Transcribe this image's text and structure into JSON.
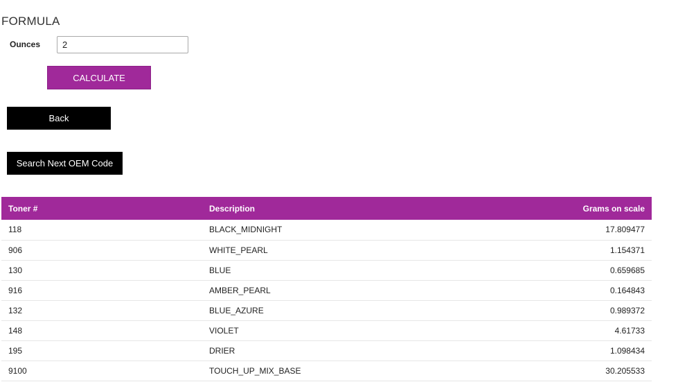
{
  "page": {
    "title": "FORMULA"
  },
  "form": {
    "ounces_label": "Ounces",
    "ounces_value": "2",
    "calculate_label": "CALCULATE",
    "back_label": "Back",
    "search_next_label": "Search Next OEM Code"
  },
  "colors": {
    "accent": "#a0299a",
    "button_dark": "#000000"
  },
  "table": {
    "headers": {
      "toner": "Toner #",
      "description": "Description",
      "grams": "Grams on scale"
    },
    "rows": [
      {
        "toner": "118",
        "description": "BLACK_MIDNIGHT",
        "grams": "17.809477"
      },
      {
        "toner": "906",
        "description": "WHITE_PEARL",
        "grams": "1.154371"
      },
      {
        "toner": "130",
        "description": "BLUE",
        "grams": "0.659685"
      },
      {
        "toner": "916",
        "description": "AMBER_PEARL",
        "grams": "0.164843"
      },
      {
        "toner": "132",
        "description": "BLUE_AZURE",
        "grams": "0.989372"
      },
      {
        "toner": "148",
        "description": "VIOLET",
        "grams": "4.61733"
      },
      {
        "toner": "195",
        "description": "DRIER",
        "grams": "1.098434"
      },
      {
        "toner": "9100",
        "description": "TOUCH_UP_MIX_BASE",
        "grams": "30.205533"
      }
    ]
  }
}
